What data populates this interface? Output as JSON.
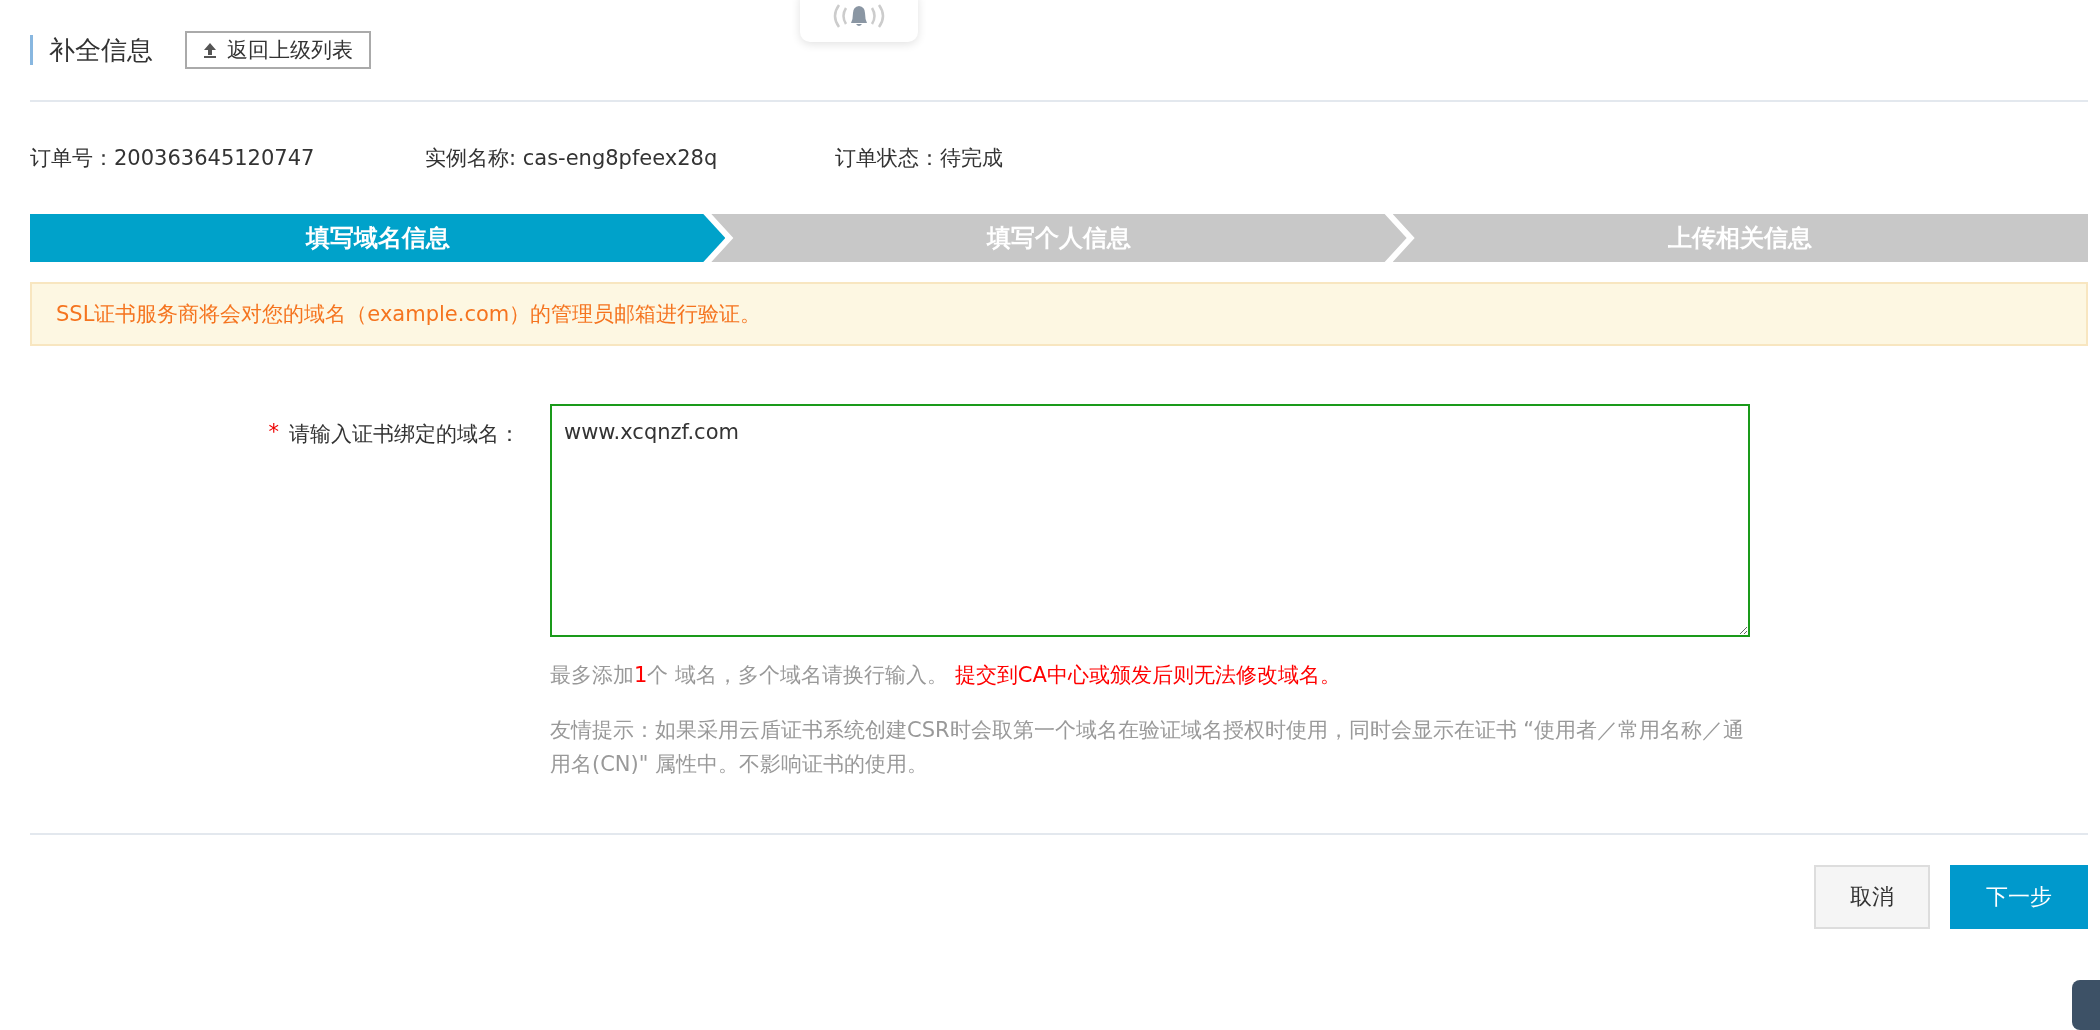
{
  "header": {
    "title": "补全信息",
    "back_button": "返回上级列表"
  },
  "order_info": [
    {
      "label": "订单号：",
      "value": "200363645120747"
    },
    {
      "label": "实例名称: ",
      "value": "cas-eng8pfeex28q"
    },
    {
      "label": "订单状态：",
      "value": "待完成"
    }
  ],
  "steps": [
    {
      "label": "填写域名信息",
      "selected": true
    },
    {
      "label": "填写个人信息",
      "selected": false
    },
    {
      "label": "上传相关信息",
      "selected": false
    }
  ],
  "alert": "SSL证书服务商将会对您的域名（example.com）的管理员邮箱进行验证。",
  "form": {
    "required_mark": "*",
    "label": "请输入证书绑定的域名：",
    "value": "www.xcqnzf.com",
    "hint": [
      {
        "kind": "plain",
        "text": "最多添加"
      },
      {
        "kind": "emphasis",
        "text": "1"
      },
      {
        "kind": "plain",
        "text": "个 域名，多个域名请换行输入。 "
      },
      {
        "kind": "emphasis",
        "text": "提交到CA中心或颁发后则无法修改域名。"
      }
    ],
    "tip": "友情提示：如果采用云盾证书系统创建CSR时会取第一个域名在验证域名授权时使用，同时会显示在证书 “使用者／常用名称／通用名(CN)\" 属性中。不影响证书的使用。"
  },
  "buttons": [
    {
      "kind": "secondary",
      "label": "取消"
    },
    {
      "kind": "primary",
      "label": "下一步"
    }
  ]
}
